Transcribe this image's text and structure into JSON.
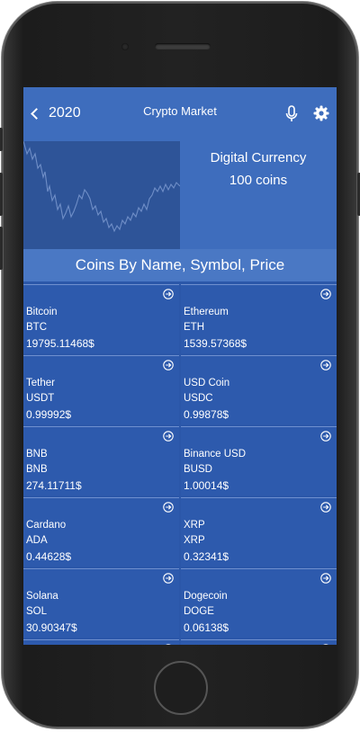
{
  "header": {
    "back_label": "2020",
    "title": "Crypto Market"
  },
  "hero": {
    "line1": "Digital Currency",
    "line2": "100 coins"
  },
  "section": {
    "title": "Coins By Name, Symbol, Price"
  },
  "colors": {
    "screen_bg": "#2b57a9",
    "appbar_bg": "#3e6dbd",
    "card_bg": "#2d5aad",
    "text": "#ffffff"
  },
  "coins": [
    {
      "name": "Bitcoin",
      "symbol": "BTC",
      "price": "19795.11468$"
    },
    {
      "name": "Ethereum",
      "symbol": "ETH",
      "price": "1539.57368$"
    },
    {
      "name": "Tether",
      "symbol": "USDT",
      "price": "0.99992$"
    },
    {
      "name": "USD Coin",
      "symbol": "USDC",
      "price": "0.99878$"
    },
    {
      "name": "BNB",
      "symbol": "BNB",
      "price": "274.11711$"
    },
    {
      "name": "Binance USD",
      "symbol": "BUSD",
      "price": "1.00014$"
    },
    {
      "name": "Cardano",
      "symbol": "ADA",
      "price": "0.44628$"
    },
    {
      "name": "XRP",
      "symbol": "XRP",
      "price": "0.32341$"
    },
    {
      "name": "Solana",
      "symbol": "SOL",
      "price": "30.90347$"
    },
    {
      "name": "Dogecoin",
      "symbol": "DOGE",
      "price": "0.06138$"
    },
    {
      "name": "",
      "symbol": "",
      "price": ""
    },
    {
      "name": "",
      "symbol": "",
      "price": ""
    }
  ]
}
